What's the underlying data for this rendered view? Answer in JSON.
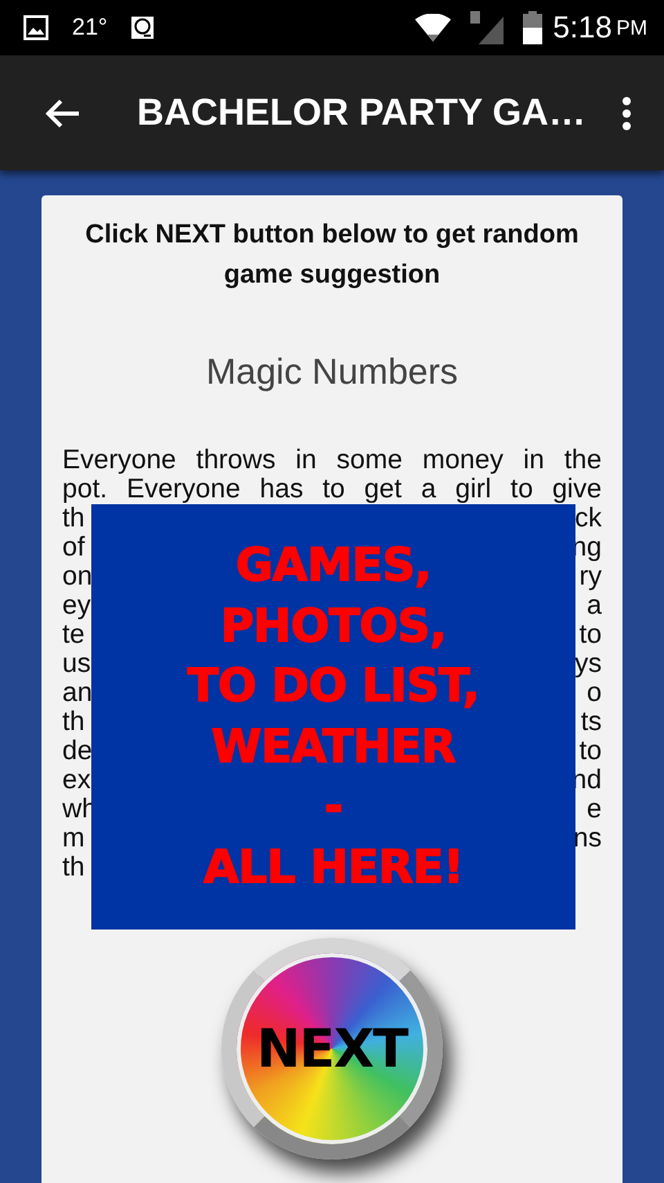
{
  "status_bar": {
    "temperature": "21°",
    "time": "5:18",
    "meridiem": "PM"
  },
  "app_bar": {
    "title": "BACHELOR PARTY GA…"
  },
  "card": {
    "instruction": "Click NEXT button below to get random game suggestion",
    "game_title": "Magic Numbers",
    "description_lines": [
      "Everyone throws in some money in the",
      "pot. Everyone has to get a girl to give"
    ],
    "partial_lines": [
      {
        "left": "th",
        "right": "ck"
      },
      {
        "left": "of",
        "right": "ng"
      },
      {
        "left": "on",
        "right": "ry"
      },
      {
        "left": "ey",
        "right": "a"
      },
      {
        "left": "te",
        "right": "to"
      },
      {
        "left": "us",
        "right": "ys"
      },
      {
        "left": "an",
        "right": "o"
      },
      {
        "left": "th",
        "right": "ts"
      },
      {
        "left": "de",
        "right": "to"
      },
      {
        "left": "ex",
        "right": "nd"
      },
      {
        "left": "wh",
        "right": "e"
      },
      {
        "left": "m",
        "right": "ns"
      },
      {
        "left": "th"
      }
    ]
  },
  "overlay_ad": {
    "lines": [
      "GAMES,",
      "PHOTOS,",
      "TO DO LIST,",
      "WEATHER",
      "-",
      "ALL HERE!"
    ]
  },
  "next_button": {
    "label": "NEXT"
  }
}
